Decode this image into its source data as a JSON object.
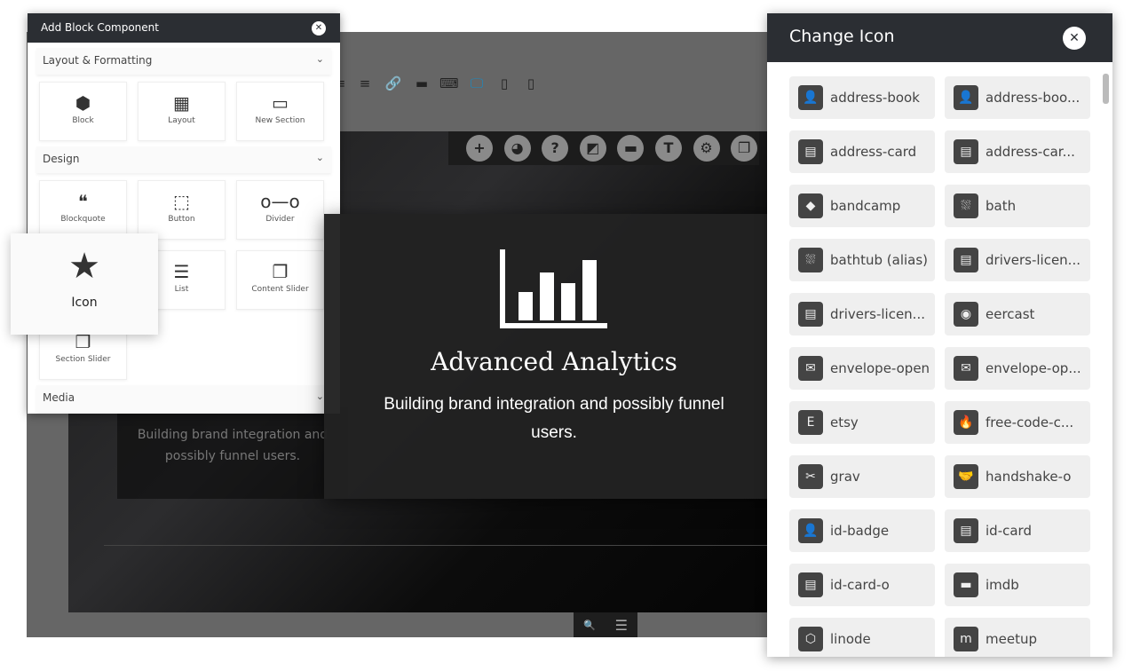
{
  "editor": {
    "toolbar_icons": [
      "align-center-icon",
      "align-right-icon",
      "link-icon",
      "horizontal-rule-icon",
      "keyboard-icon",
      "desktop-icon",
      "tablet-icon",
      "mobile-icon"
    ],
    "active_toolbar_icon": "desktop-icon",
    "accent": "#1a8ac2",
    "round_buttons": [
      {
        "name": "add",
        "glyph": "+"
      },
      {
        "name": "globe",
        "glyph": "◕"
      },
      {
        "name": "help",
        "glyph": "?"
      },
      {
        "name": "image",
        "glyph": "◩"
      },
      {
        "name": "layout",
        "glyph": "▬"
      },
      {
        "name": "text",
        "glyph": "T"
      },
      {
        "name": "settings",
        "glyph": "⚙"
      },
      {
        "name": "slider",
        "glyph": "❐"
      }
    ],
    "ghost_text": "Building brand integration and possibly funnel users.",
    "bottom": {
      "zoom": "🔍",
      "menu": "☰"
    }
  },
  "left_panel": {
    "title": "Add Block Component",
    "close": "✕",
    "sections": [
      {
        "label": "Layout & Formatting",
        "tiles": [
          {
            "label": "Block",
            "glyph": "⬢"
          },
          {
            "label": "Layout",
            "glyph": "▦"
          },
          {
            "label": "New Section",
            "glyph": "▭"
          }
        ]
      },
      {
        "label": "Design",
        "tiles": [
          {
            "label": "Blockquote",
            "glyph": "❝"
          },
          {
            "label": "Button",
            "glyph": "⬚"
          },
          {
            "label": "Divider",
            "glyph": "o—o"
          },
          {
            "label": "Icon",
            "glyph": "★"
          },
          {
            "label": "List",
            "glyph": "☰"
          },
          {
            "label": "Content Slider",
            "glyph": "❐"
          },
          {
            "label": "Section Slider",
            "glyph": "❐"
          }
        ]
      },
      {
        "label": "Media"
      }
    ],
    "chevron": "⌄"
  },
  "icon_popup": {
    "label": "Icon",
    "glyph": "★"
  },
  "center_card": {
    "title": "Advanced Analytics",
    "description": "Building brand integration and possibly funnel users."
  },
  "right_panel": {
    "title": "Change Icon",
    "close": "✕",
    "items": [
      {
        "label": "address-book",
        "glyph": "👤"
      },
      {
        "label": "address-boo...",
        "glyph": "👤"
      },
      {
        "label": "address-card",
        "glyph": "▤"
      },
      {
        "label": "address-car...",
        "glyph": "▤"
      },
      {
        "label": "bandcamp",
        "glyph": "◆"
      },
      {
        "label": "bath",
        "glyph": "⛆"
      },
      {
        "label": "bathtub (alias)",
        "glyph": "⛆"
      },
      {
        "label": "drivers-licen...",
        "glyph": "▤"
      },
      {
        "label": "drivers-licen...",
        "glyph": "▤"
      },
      {
        "label": "eercast",
        "glyph": "◉"
      },
      {
        "label": "envelope-open",
        "glyph": "✉"
      },
      {
        "label": "envelope-op...",
        "glyph": "✉"
      },
      {
        "label": "etsy",
        "glyph": "E"
      },
      {
        "label": "free-code-c...",
        "glyph": "🔥"
      },
      {
        "label": "grav",
        "glyph": "✂"
      },
      {
        "label": "handshake-o",
        "glyph": "🤝"
      },
      {
        "label": "id-badge",
        "glyph": "👤"
      },
      {
        "label": "id-card",
        "glyph": "▤"
      },
      {
        "label": "id-card-o",
        "glyph": "▤"
      },
      {
        "label": "imdb",
        "glyph": "▬"
      },
      {
        "label": "linode",
        "glyph": "⬡"
      },
      {
        "label": "meetup",
        "glyph": "m"
      }
    ]
  }
}
